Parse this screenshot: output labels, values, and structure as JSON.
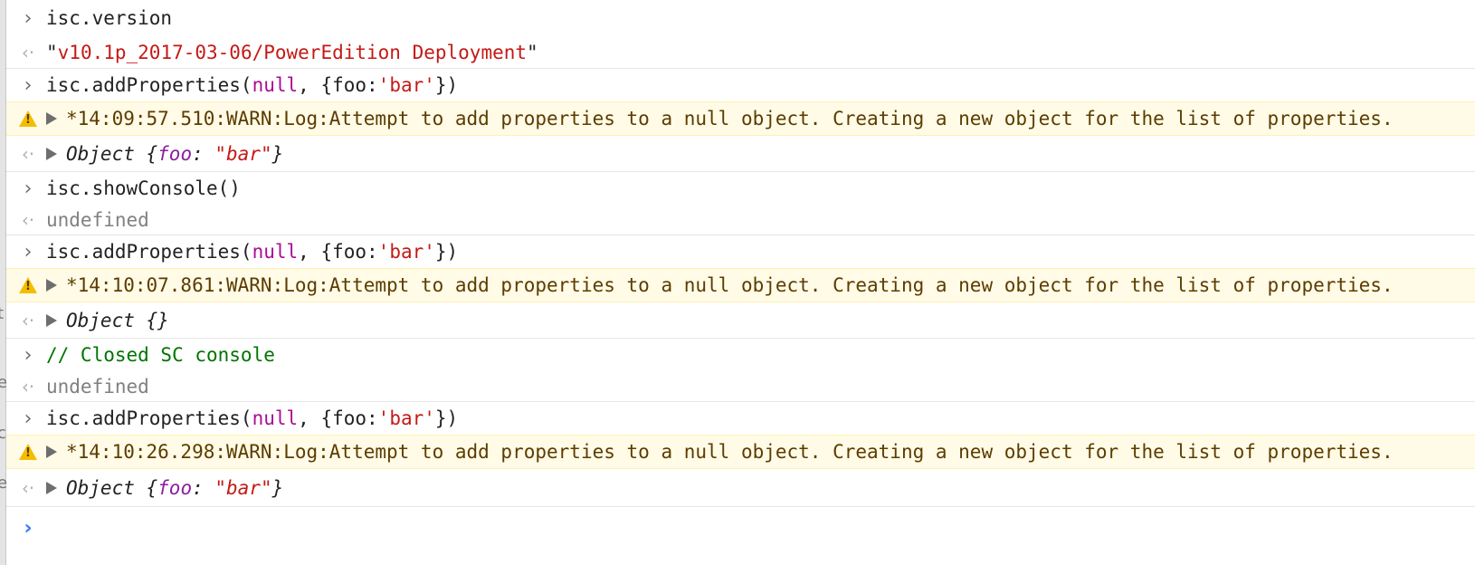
{
  "console": {
    "entries": [
      {
        "kind": "input",
        "text": "isc.version"
      },
      {
        "kind": "output",
        "q1": "\"",
        "value": "v10.1p_2017-03-06/PowerEdition Deployment",
        "q2": "\""
      },
      {
        "kind": "input",
        "pre": "isc.addProperties(",
        "kw": "null",
        "mid": ", {foo:",
        "str": "'bar'",
        "post": "})"
      },
      {
        "kind": "warning",
        "text": "*14:09:57.510:WARN:Log:Attempt to add properties to a null object. Creating a new object for the list of properties."
      },
      {
        "kind": "output-object",
        "label": "Object {",
        "prop": "foo",
        "colon": ": ",
        "value": "\"bar\"",
        "close": "}"
      },
      {
        "kind": "input",
        "text": "isc.showConsole()"
      },
      {
        "kind": "output",
        "text": "undefined"
      },
      {
        "kind": "input",
        "pre": "isc.addProperties(",
        "kw": "null",
        "mid": ", {foo:",
        "str": "'bar'",
        "post": "})"
      },
      {
        "kind": "warning",
        "text": "*14:10:07.861:WARN:Log:Attempt to add properties to a null object. Creating a new object for the list of properties."
      },
      {
        "kind": "output-object",
        "label": "Object {}"
      },
      {
        "kind": "input",
        "text": "// Closed SC console"
      },
      {
        "kind": "output",
        "text": "undefined"
      },
      {
        "kind": "input",
        "pre": "isc.addProperties(",
        "kw": "null",
        "mid": ", {foo:",
        "str": "'bar'",
        "post": "})"
      },
      {
        "kind": "warning",
        "text": "*14:10:26.298:WARN:Log:Attempt to add properties to a null object. Creating a new object for the list of properties."
      },
      {
        "kind": "output-object",
        "label": "Object {",
        "prop": "foo",
        "colon": ": ",
        "value": "\"bar\"",
        "close": "}"
      }
    ],
    "edge_glyphs": [
      "t",
      "e",
      "c",
      "e"
    ],
    "colors": {
      "string": "#c41a16",
      "keyword": "#aa0d91",
      "comment": "#007400",
      "warning_bg": "#fffbe6",
      "prompt": "#2f7cf6"
    }
  }
}
